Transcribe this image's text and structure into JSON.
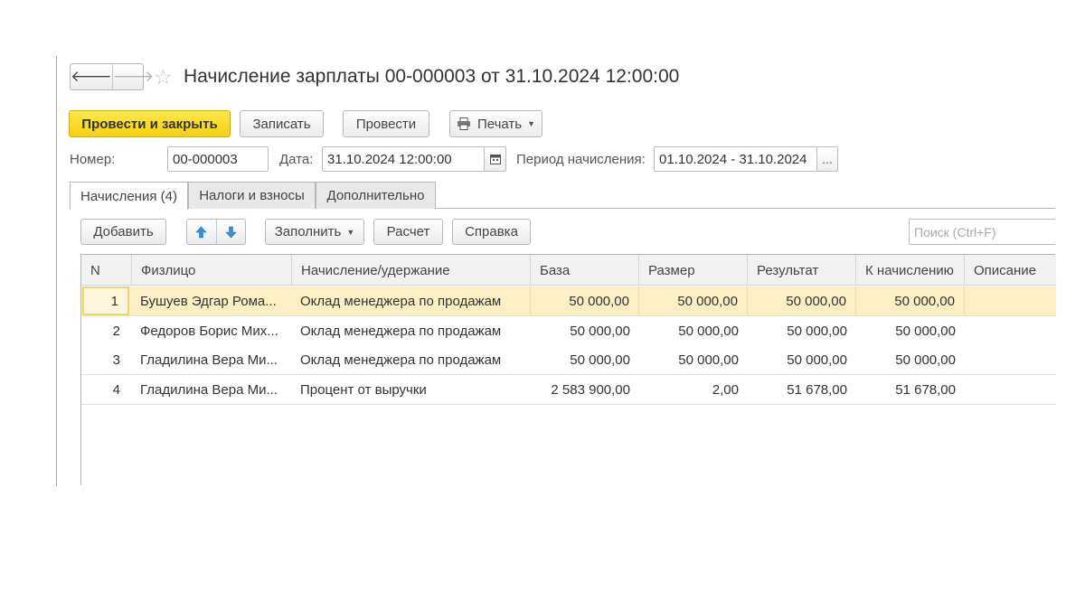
{
  "window": {
    "title": "Начисление зарплаты 00-000003 от 31.10.2024 12:00:00",
    "nav": {
      "back": "🡐",
      "forward": "🡒"
    },
    "favorite_icon": "star-icon"
  },
  "toolbar": {
    "post_and_close": "Провести и закрыть",
    "save": "Записать",
    "post": "Провести",
    "print": "Печать"
  },
  "header": {
    "number_label": "Номер:",
    "number_value": "00-000003",
    "date_label": "Дата:",
    "date_value": "31.10.2024 12:00:00",
    "period_label": "Период начисления:",
    "period_value": "01.10.2024 - 31.10.2024",
    "period_select": "..."
  },
  "tabs": [
    {
      "label": "Начисления (4)",
      "active": true
    },
    {
      "label": "Налоги и взносы",
      "active": false
    },
    {
      "label": "Дополнительно",
      "active": false
    }
  ],
  "grid_toolbar": {
    "add": "Добавить",
    "fill": "Заполнить",
    "calc": "Расчет",
    "help": "Справка",
    "search_placeholder": "Поиск (Ctrl+F)"
  },
  "table": {
    "columns": [
      "N",
      "Физлицо",
      "Начисление/удержание",
      "База",
      "Размер",
      "Результат",
      "К начислению",
      "Описание"
    ],
    "rows": [
      {
        "n": "1",
        "person": "Бушуев Эдгар Рома...",
        "accrual": "Оклад менеджера по продажам",
        "base": "50 000,00",
        "size": "50 000,00",
        "result": "50 000,00",
        "to_accrue": "50 000,00",
        "description": ""
      },
      {
        "n": "2",
        "person": "Федоров Борис Мих...",
        "accrual": "Оклад менеджера по продажам",
        "base": "50 000,00",
        "size": "50 000,00",
        "result": "50 000,00",
        "to_accrue": "50 000,00",
        "description": ""
      },
      {
        "n": "3",
        "person": "Гладилина Вера Ми...",
        "accrual": "Оклад менеджера по продажам",
        "base": "50 000,00",
        "size": "50 000,00",
        "result": "50 000,00",
        "to_accrue": "50 000,00",
        "description": ""
      },
      {
        "n": "4",
        "person": "Гладилина Вера Ми...",
        "accrual": "Процент от выручки",
        "base": "2 583 900,00",
        "size": "2,00",
        "result": "51 678,00",
        "to_accrue": "51 678,00",
        "description": ""
      }
    ],
    "selected_row": 0
  },
  "colors": {
    "primary_button": "#f5cf10",
    "selected_row": "#fbf0c4",
    "arrow_icon": "#3d8ed6"
  }
}
